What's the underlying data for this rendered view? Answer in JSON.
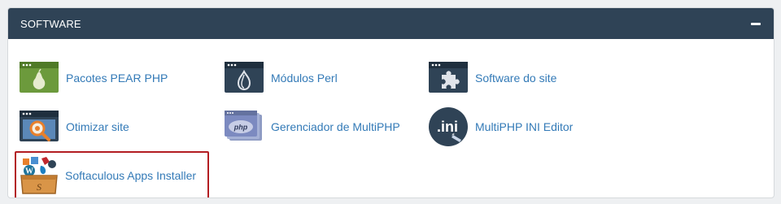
{
  "panel": {
    "title": "SOFTWARE",
    "collapse_icon": "minus-icon"
  },
  "items": [
    {
      "label": "Pacotes PEAR PHP",
      "icon": "pear-icon"
    },
    {
      "label": "Módulos Perl",
      "icon": "onion-icon"
    },
    {
      "label": "Software do site",
      "icon": "puzzle-icon"
    },
    {
      "label": "Otimizar site",
      "icon": "magnifier-gear-icon"
    },
    {
      "label": "Gerenciador de MultiPHP",
      "icon": "php-icon"
    },
    {
      "label": "MultiPHP INI Editor",
      "icon": "ini-file-icon"
    },
    {
      "label": "Softaculous Apps Installer",
      "icon": "softaculous-icon"
    }
  ],
  "icon_text": {
    "php": "php",
    "ini": ".ini"
  },
  "colors": {
    "header_bg": "#2f4356",
    "link": "#337ab7",
    "highlight_border": "#b31d22"
  }
}
